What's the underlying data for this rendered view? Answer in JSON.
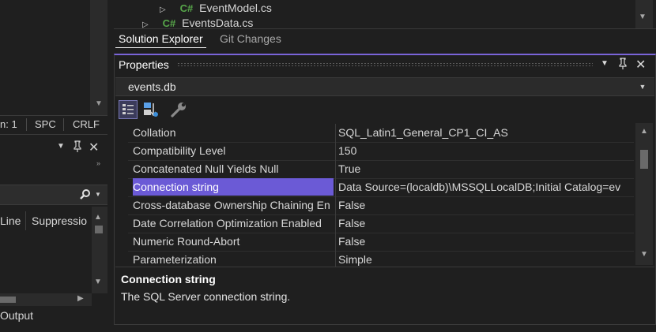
{
  "solution_explorer": {
    "tree_items": [
      {
        "badge": "C#",
        "label": "EventModel.cs"
      },
      {
        "badge": "C#",
        "label": "EventsData.cs"
      }
    ],
    "tabs": [
      {
        "label": "Solution Explorer",
        "active": true
      },
      {
        "label": "Git Changes",
        "active": false
      }
    ]
  },
  "status_bar": {
    "line_label": "n: 1",
    "spc_label": "SPC",
    "crlf_label": "CRLF"
  },
  "error_list": {
    "columns": [
      "Line",
      "Suppressio"
    ],
    "search_icon": "search-icon",
    "bottom_tab": "Output"
  },
  "properties": {
    "title": "Properties",
    "object": "events.db",
    "rows": [
      {
        "name": "Collation",
        "value": "SQL_Latin1_General_CP1_CI_AS"
      },
      {
        "name": "Compatibility Level",
        "value": "150"
      },
      {
        "name": "Concatenated Null Yields Null",
        "value": "True"
      },
      {
        "name": "Connection string",
        "value": "Data Source=(localdb)\\MSSQLLocalDB;Initial Catalog=ev"
      },
      {
        "name": "Cross-database Ownership Chaining En",
        "value": "False"
      },
      {
        "name": "Date Correlation Optimization Enabled",
        "value": "False"
      },
      {
        "name": "Numeric Round-Abort",
        "value": "False"
      },
      {
        "name": "Parameterization",
        "value": "Simple"
      }
    ],
    "selected_index": 3,
    "description": {
      "title": "Connection string",
      "text": "The SQL Server connection string."
    }
  },
  "colors": {
    "accent": "#7a64d8",
    "selection": "#6b5ad6",
    "csharp_badge": "#57a64a"
  }
}
